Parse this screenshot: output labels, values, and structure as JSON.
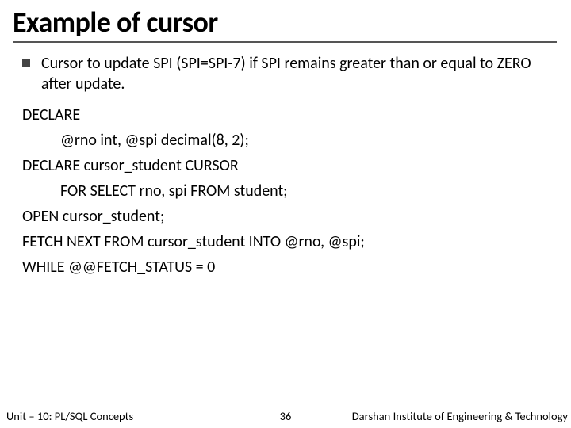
{
  "title": "Example of cursor",
  "bullet": "Cursor to update SPI (SPI=SPI-7) if SPI remains greater than or equal to ZERO after update.",
  "code": {
    "l1": "DECLARE",
    "l2": "@rno int, @spi decimal(8, 2);",
    "l3": "DECLARE cursor_student CURSOR",
    "l4": "FOR SELECT rno, spi FROM student;",
    "l5": "OPEN cursor_student;",
    "l6": "FETCH NEXT FROM cursor_student INTO @rno, @spi;",
    "l7": "WHILE @@FETCH_STATUS = 0"
  },
  "footer": {
    "left": "Unit – 10: PL/SQL Concepts",
    "page": "36",
    "right": "Darshan Institute of Engineering & Technology"
  }
}
